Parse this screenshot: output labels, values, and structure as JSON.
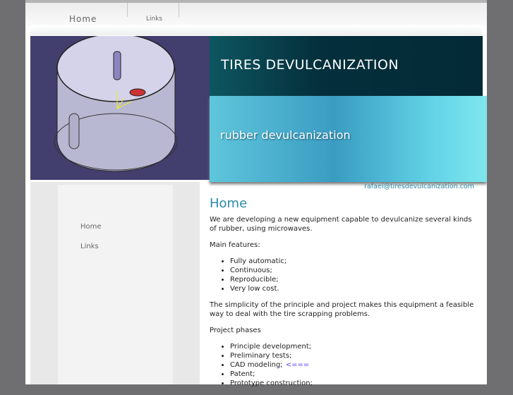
{
  "nav": {
    "items": [
      {
        "label": "Home"
      },
      {
        "label": "Links"
      }
    ]
  },
  "banner": {
    "title": "TIRES DEVULCANIZATION",
    "subtitle": "rubber devulcanization"
  },
  "sidebar": {
    "items": [
      {
        "label": "Home"
      },
      {
        "label": "Links"
      }
    ]
  },
  "contact_email": "rafael@tiresdevulcanization.com",
  "content": {
    "heading": "Home",
    "intro": "We are developing a new equipment capable to devulcanize several kinds of rubber, using microwaves.",
    "features_label": "Main features:",
    "features": [
      "Fully automatic;",
      "Continuous;",
      "Reproducible;",
      "Very low cost."
    ],
    "simplicity": "The simplicity of the principle and project makes this equipment a feasible way to deal with the tire scrapping problems.",
    "phases_label": "Project phases",
    "phases": [
      "Principle development;",
      "Preliminary tests;",
      "CAD modeling;",
      "Patent;",
      "Prototype construction;"
    ],
    "current_marker": "<==="
  }
}
